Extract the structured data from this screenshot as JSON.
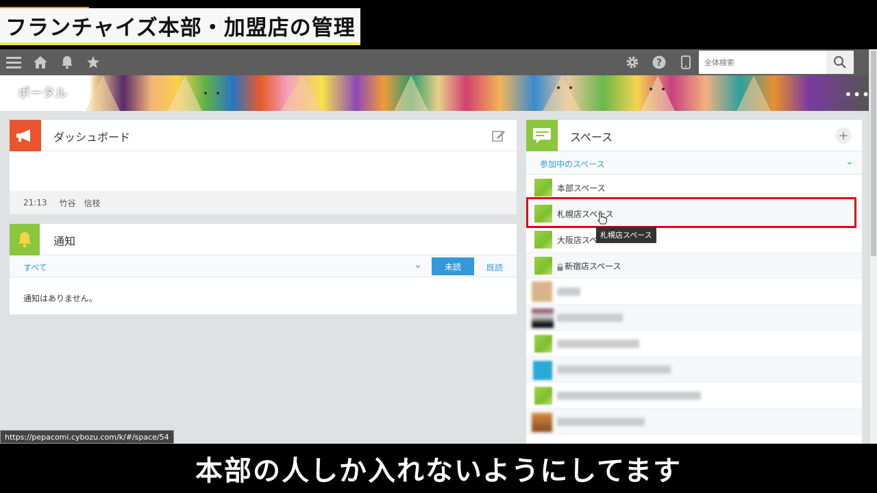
{
  "video": {
    "title": "フランチャイズ本部・加盟店の管理",
    "subtitle": "本部の人しか入れないようにしてます"
  },
  "topbar": {
    "search_placeholder": "全体検索",
    "icons": [
      "menu-icon",
      "home-icon",
      "bell-icon",
      "star-icon",
      "gear-icon",
      "help-icon",
      "mobile-icon",
      "search-icon"
    ]
  },
  "banner": {
    "title": "ポータル",
    "more": "•••"
  },
  "dashboard": {
    "title": "ダッシュボード",
    "time": "21:13",
    "user": "竹谷　信枝"
  },
  "notifications": {
    "title": "通知",
    "filter_all": "すべて",
    "unread": "未読",
    "read": "既読",
    "empty": "通知はありません。"
  },
  "spaces": {
    "title": "スペース",
    "add": "+",
    "section": "参加中のスペース",
    "items": [
      {
        "name": "本部スペース"
      },
      {
        "name": "札幌店スペース"
      },
      {
        "name": "大阪店スペース"
      },
      {
        "name": "新宿店スペース"
      }
    ],
    "tooltip": "札幌店スペース"
  },
  "status_url": "https://pepacomi.cybozu.com/k/#/space/54",
  "colors": {
    "accent_blue": "#3498db",
    "highlight_red": "#e0001a",
    "topbar": "#5d5d5d",
    "dashboard_icon": "#e8552e",
    "notify_icon": "#8cc63f",
    "space_icon": "#8cc63f"
  }
}
